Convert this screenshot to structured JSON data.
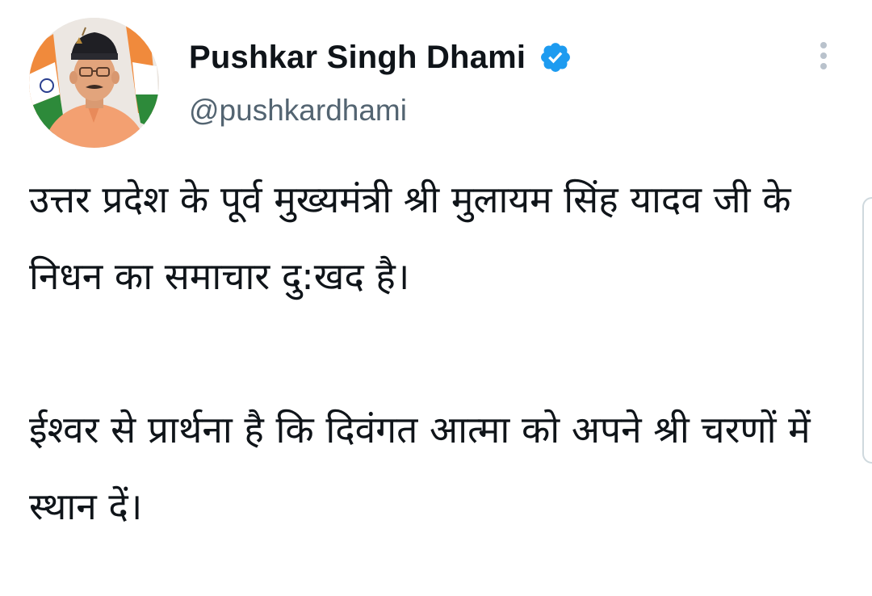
{
  "author": {
    "display_name": "Pushkar Singh Dhami",
    "handle": "@pushkardhami",
    "verified": true,
    "avatar": "profile-photo"
  },
  "tweet": {
    "text": "उत्तर प्रदेश के पूर्व मुख्यमंत्री श्री मुलायम सिंह यादव जी के निधन का समाचार दु:खद है।\n\nईश्वर से प्रार्थना है कि दिवंगत आत्मा को अपने श्री चरणों में स्थान दें।"
  },
  "icons": {
    "verified": "verified-badge-icon",
    "more": "more-options-vertical-icon"
  },
  "colors": {
    "text_primary": "#0f1419",
    "text_secondary": "#536471",
    "verified_blue": "#1d9bf0",
    "icon_gray": "#b9c2cc"
  }
}
